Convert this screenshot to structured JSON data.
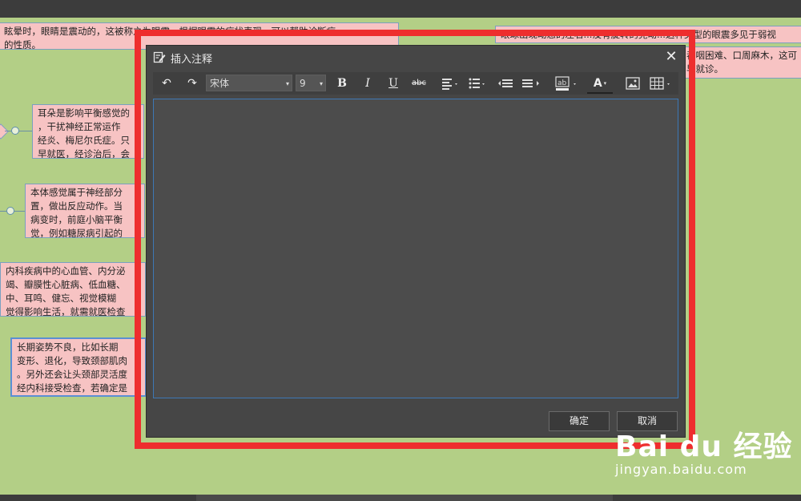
{
  "dialog": {
    "title": "插入注释",
    "close_glyph": "✕",
    "ok_label": "确定",
    "cancel_label": "取消"
  },
  "toolbar": {
    "undo_glyph": "↶",
    "redo_glyph": "↷",
    "font_family": "宋体",
    "font_size": "9",
    "bold": "B",
    "italic": "I",
    "underline": "U",
    "strike": "abc",
    "font_color_glyph": "A",
    "caret": "▾"
  },
  "mindmap": {
    "top_left_text": "眩晕时，眼睛是震动的，这被称之为眼震，根据眼震的症状表现，可以帮助诊断症\n的性质。",
    "top_right_text": "眼球出现动态的左右...没有旋转的晃动...这种类型的眼震多见于弱视",
    "right_text": "吞咽困难、口周麻木，这可\n早就诊。",
    "node1_text": "耳朵是影响平衡感觉的\n，干扰神经正常运作\n经炎、梅尼尔氏症。只\n早就医，经诊治后，会",
    "node2_text": "本体感觉属于神经部分\n置，做出反应动作。当\n病变时，前庭小脑平衡\n觉，例如糖尿病引起的",
    "node3_text": "内科疾病中的心血管、内分泌\n竭、瓣膜性心脏病、低血糖、\n中、耳鸣、健忘、视觉模糊\n觉得影响生活，就需就医检查",
    "node4_text": "长期姿势不良，比如长期\n变形、退化，导致颈部肌肉\n。另外还会让头颈部灵活度\n经内科接受检查，若确定是"
  },
  "watermark": {
    "logo": "Bai du 经验",
    "sub": "jingyan.baidu.com"
  },
  "colors": {
    "background": "#b3cf86",
    "node_fill": "#f7c3c3",
    "dialog_bg": "#464646",
    "highlight": "#ee2e2e"
  }
}
